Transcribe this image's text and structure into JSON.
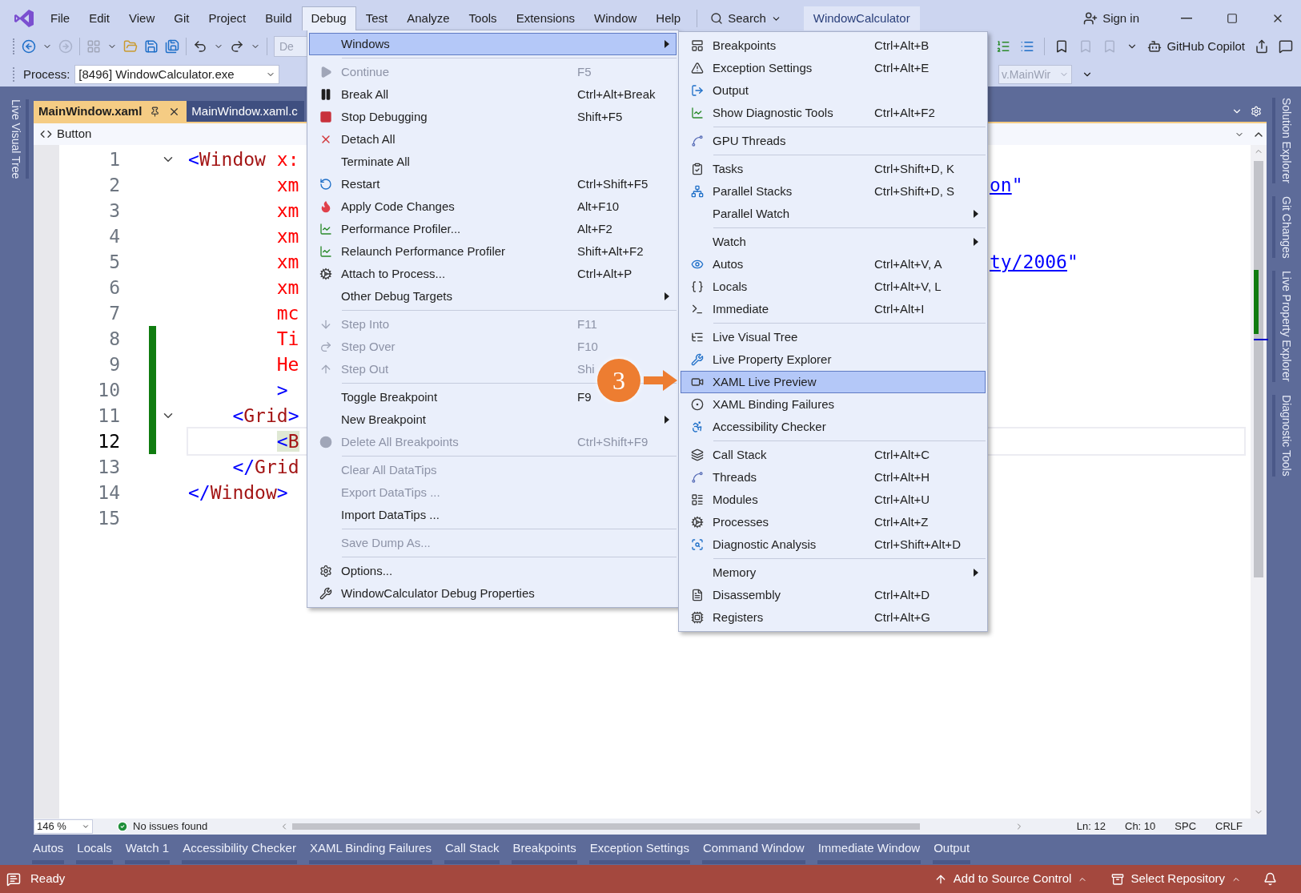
{
  "title_bar": {
    "menu": [
      {
        "label": "File",
        "selected": false
      },
      {
        "label": "Edit",
        "selected": false
      },
      {
        "label": "View",
        "selected": false
      },
      {
        "label": "Git",
        "selected": false
      },
      {
        "label": "Project",
        "selected": false
      },
      {
        "label": "Build",
        "selected": false
      },
      {
        "label": "Debug",
        "selected": true
      },
      {
        "label": "Test",
        "selected": false
      },
      {
        "label": "Analyze",
        "selected": false
      },
      {
        "label": "Tools",
        "selected": false
      },
      {
        "label": "Extensions",
        "selected": false
      },
      {
        "label": "Window",
        "selected": false
      },
      {
        "label": "Help",
        "selected": false
      }
    ],
    "search": "Search",
    "solution": "WindowCalculator",
    "sign_in": "Sign in"
  },
  "toolbar": {
    "config_field": "De",
    "process_label": "Process:",
    "process_value": "[8496] WindowCalculator.exe",
    "frame_field": "v.MainWir",
    "copilot": "GitHub Copilot"
  },
  "left_tool_tabs": [
    "Live Visual Tree"
  ],
  "document_tabs": [
    {
      "label": "MainWindow.xaml",
      "selected": true
    },
    {
      "label": "MainWindow.xaml.c",
      "selected": false
    }
  ],
  "nav_bar": {
    "element": "Button"
  },
  "editor": {
    "lines": [
      {
        "number": "1",
        "changed": false,
        "current": false,
        "foldable": true,
        "bracket_match": false,
        "segments": [
          {
            "kind": "bracket",
            "text": "<"
          },
          {
            "kind": "element",
            "text": "Window"
          },
          {
            "kind": "attribute",
            "text": " x:"
          }
        ]
      },
      {
        "number": "2",
        "changed": false,
        "current": false,
        "foldable": false,
        "bracket_match": false,
        "segments": [
          {
            "kind": "attribute",
            "text": "        xm"
          }
        ],
        "right_segments": [
          {
            "kind": "link",
            "text": "on"
          },
          {
            "kind": "bracket",
            "text": "\""
          }
        ]
      },
      {
        "number": "3",
        "changed": false,
        "current": false,
        "foldable": false,
        "bracket_match": false,
        "segments": [
          {
            "kind": "attribute",
            "text": "        xm"
          }
        ]
      },
      {
        "number": "4",
        "changed": false,
        "current": false,
        "foldable": false,
        "bracket_match": false,
        "segments": [
          {
            "kind": "attribute",
            "text": "        xm"
          }
        ]
      },
      {
        "number": "5",
        "changed": false,
        "current": false,
        "foldable": false,
        "bracket_match": false,
        "segments": [
          {
            "kind": "attribute",
            "text": "        xm"
          }
        ],
        "right_segments": [
          {
            "kind": "link",
            "text": "ty/2006"
          },
          {
            "kind": "bracket",
            "text": "\""
          }
        ]
      },
      {
        "number": "6",
        "changed": false,
        "current": false,
        "foldable": false,
        "bracket_match": false,
        "segments": [
          {
            "kind": "attribute",
            "text": "        xm"
          }
        ]
      },
      {
        "number": "7",
        "changed": false,
        "current": false,
        "foldable": false,
        "bracket_match": false,
        "segments": [
          {
            "kind": "attribute",
            "text": "        mc"
          }
        ]
      },
      {
        "number": "8",
        "changed": true,
        "current": false,
        "foldable": false,
        "bracket_match": false,
        "segments": [
          {
            "kind": "attribute",
            "text": "        Ti"
          }
        ]
      },
      {
        "number": "9",
        "changed": true,
        "current": false,
        "foldable": false,
        "bracket_match": false,
        "segments": [
          {
            "kind": "attribute",
            "text": "        He"
          }
        ]
      },
      {
        "number": "10",
        "changed": true,
        "current": false,
        "foldable": false,
        "bracket_match": false,
        "segments": [
          {
            "kind": "bracket",
            "text": "        >"
          }
        ]
      },
      {
        "number": "11",
        "changed": true,
        "current": false,
        "foldable": true,
        "bracket_match": false,
        "segments": [
          {
            "kind": "bracket",
            "text": "    <"
          },
          {
            "kind": "element",
            "text": "Grid"
          },
          {
            "kind": "bracket",
            "text": ">"
          }
        ]
      },
      {
        "number": "12",
        "changed": true,
        "current": true,
        "foldable": false,
        "bracket_match": true,
        "segments": [
          {
            "kind": "bracket",
            "text": "        <"
          },
          {
            "kind": "element",
            "text": "B"
          }
        ]
      },
      {
        "number": "13",
        "changed": false,
        "current": false,
        "foldable": false,
        "bracket_match": false,
        "segments": [
          {
            "kind": "bracket",
            "text": "    </"
          },
          {
            "kind": "element",
            "text": "Grid"
          }
        ]
      },
      {
        "number": "14",
        "changed": false,
        "current": false,
        "foldable": false,
        "bracket_match": false,
        "segments": [
          {
            "kind": "bracket",
            "text": "</"
          },
          {
            "kind": "element",
            "text": "Window"
          },
          {
            "kind": "bracket",
            "text": ">"
          }
        ]
      },
      {
        "number": "15",
        "changed": false,
        "current": false,
        "foldable": false,
        "bracket_match": false
      }
    ]
  },
  "editor_status": {
    "zoom": "146 %",
    "issues": "No issues found",
    "line": "Ln: 12",
    "column": "Ch: 10",
    "whitespace": "SPC",
    "line_ending": "CRLF"
  },
  "right_tool_tabs": [
    "Solution Explorer",
    "Git Changes",
    "Live Property Explorer",
    "Diagnostic Tools"
  ],
  "bottom_tool_tabs": [
    "Autos",
    "Locals",
    "Watch 1",
    "Accessibility Checker",
    "XAML Binding Failures",
    "Call Stack",
    "Breakpoints",
    "Exception Settings",
    "Command Window",
    "Immediate Window",
    "Output"
  ],
  "status_bar": {
    "state": "Ready",
    "source_control": "Add to Source Control",
    "repository": "Select Repository"
  },
  "debug_menu": {
    "sections": [
      [
        {
          "label": "Windows",
          "disabled": false,
          "selected": true,
          "submenu": true
        }
      ],
      [
        {
          "label": "Continue",
          "shortcut": "F5",
          "disabled": true,
          "selected": false,
          "submenu": false
        },
        {
          "label": "Break All",
          "shortcut": "Ctrl+Alt+Break",
          "disabled": false,
          "selected": false,
          "submenu": false
        },
        {
          "label": "Stop Debugging",
          "shortcut": "Shift+F5",
          "disabled": false,
          "selected": false,
          "submenu": false
        },
        {
          "label": "Detach All",
          "disabled": false,
          "selected": false,
          "submenu": false
        },
        {
          "label": "Terminate All",
          "disabled": false,
          "selected": false,
          "submenu": false
        },
        {
          "label": "Restart",
          "shortcut": "Ctrl+Shift+F5",
          "disabled": false,
          "selected": false,
          "submenu": false
        },
        {
          "label": "Apply Code Changes",
          "shortcut": "Alt+F10",
          "disabled": false,
          "selected": false,
          "submenu": false
        },
        {
          "label": "Performance Profiler...",
          "shortcut": "Alt+F2",
          "disabled": false,
          "selected": false,
          "submenu": false
        },
        {
          "label": "Relaunch Performance Profiler",
          "shortcut": "Shift+Alt+F2",
          "disabled": false,
          "selected": false,
          "submenu": false
        },
        {
          "label": "Attach to Process...",
          "shortcut": "Ctrl+Alt+P",
          "disabled": false,
          "selected": false,
          "submenu": false
        },
        {
          "label": "Other Debug Targets",
          "disabled": false,
          "selected": false,
          "submenu": true
        }
      ],
      [
        {
          "label": "Step Into",
          "shortcut": "F11",
          "disabled": true,
          "selected": false,
          "submenu": false
        },
        {
          "label": "Step Over",
          "shortcut": "F10",
          "disabled": true,
          "selected": false,
          "submenu": false
        },
        {
          "label": "Step Out",
          "shortcut": "Shi",
          "disabled": true,
          "selected": false,
          "submenu": false
        }
      ],
      [
        {
          "label": "Toggle Breakpoint",
          "shortcut": "F9",
          "disabled": false,
          "selected": false,
          "submenu": false
        },
        {
          "label": "New Breakpoint",
          "disabled": false,
          "selected": false,
          "submenu": true
        },
        {
          "label": "Delete All Breakpoints",
          "shortcut": "Ctrl+Shift+F9",
          "disabled": true,
          "selected": false,
          "submenu": false
        }
      ],
      [
        {
          "label": "Clear All DataTips",
          "disabled": true,
          "selected": false,
          "submenu": false
        },
        {
          "label": "Export DataTips ...",
          "disabled": true,
          "selected": false,
          "submenu": false
        },
        {
          "label": "Import DataTips ...",
          "disabled": false,
          "selected": false,
          "submenu": false
        }
      ],
      [
        {
          "label": "Save Dump As...",
          "disabled": true,
          "selected": false,
          "submenu": false
        }
      ],
      [
        {
          "label": "Options...",
          "disabled": false,
          "selected": false,
          "submenu": false
        },
        {
          "label": "WindowCalculator Debug Properties",
          "disabled": false,
          "selected": false,
          "submenu": false
        }
      ]
    ]
  },
  "windows_submenu": {
    "sections": [
      [
        {
          "label": "Breakpoints",
          "shortcut": "Ctrl+Alt+B",
          "selected": false,
          "submenu": false
        },
        {
          "label": "Exception Settings",
          "shortcut": "Ctrl+Alt+E",
          "selected": false,
          "submenu": false
        },
        {
          "label": "Output",
          "selected": false,
          "submenu": false
        },
        {
          "label": "Show Diagnostic Tools",
          "shortcut": "Ctrl+Alt+F2",
          "selected": false,
          "submenu": false
        }
      ],
      [
        {
          "label": "GPU Threads",
          "selected": false,
          "submenu": false
        }
      ],
      [
        {
          "label": "Tasks",
          "shortcut": "Ctrl+Shift+D, K",
          "selected": false,
          "submenu": false
        },
        {
          "label": "Parallel Stacks",
          "shortcut": "Ctrl+Shift+D, S",
          "selected": false,
          "submenu": false
        },
        {
          "label": "Parallel Watch",
          "selected": false,
          "submenu": true
        }
      ],
      [
        {
          "label": "Watch",
          "selected": false,
          "submenu": true
        },
        {
          "label": "Autos",
          "shortcut": "Ctrl+Alt+V, A",
          "selected": false,
          "submenu": false
        },
        {
          "label": "Locals",
          "shortcut": "Ctrl+Alt+V, L",
          "selected": false,
          "submenu": false
        },
        {
          "label": "Immediate",
          "shortcut": "Ctrl+Alt+I",
          "selected": false,
          "submenu": false
        }
      ],
      [
        {
          "label": "Live Visual Tree",
          "selected": false,
          "submenu": false
        },
        {
          "label": "Live Property Explorer",
          "selected": false,
          "submenu": false
        },
        {
          "label": "XAML Live Preview",
          "selected": true,
          "submenu": false
        },
        {
          "label": "XAML Binding Failures",
          "selected": false,
          "submenu": false
        },
        {
          "label": "Accessibility Checker",
          "selected": false,
          "submenu": false
        }
      ],
      [
        {
          "label": "Call Stack",
          "shortcut": "Ctrl+Alt+C",
          "selected": false,
          "submenu": false
        },
        {
          "label": "Threads",
          "shortcut": "Ctrl+Alt+H",
          "selected": false,
          "submenu": false
        },
        {
          "label": "Modules",
          "shortcut": "Ctrl+Alt+U",
          "selected": false,
          "submenu": false
        },
        {
          "label": "Processes",
          "shortcut": "Ctrl+Alt+Z",
          "selected": false,
          "submenu": false
        },
        {
          "label": "Diagnostic Analysis",
          "shortcut": "Ctrl+Shift+Alt+D",
          "selected": false,
          "submenu": false
        }
      ],
      [
        {
          "label": "Memory",
          "selected": false,
          "submenu": true
        },
        {
          "label": "Disassembly",
          "shortcut": "Ctrl+Alt+D",
          "selected": false,
          "submenu": false
        },
        {
          "label": "Registers",
          "shortcut": "Ctrl+Alt+G",
          "selected": false,
          "submenu": false
        }
      ]
    ]
  },
  "annotation": {
    "label": "3"
  }
}
